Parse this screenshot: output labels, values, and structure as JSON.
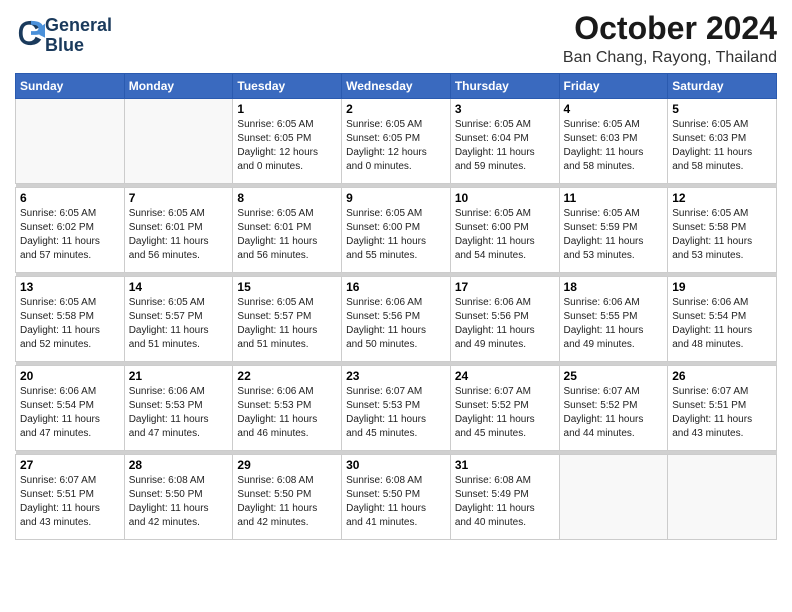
{
  "header": {
    "logo_line1": "General",
    "logo_line2": "Blue",
    "month": "October 2024",
    "location": "Ban Chang, Rayong, Thailand"
  },
  "weekdays": [
    "Sunday",
    "Monday",
    "Tuesday",
    "Wednesday",
    "Thursday",
    "Friday",
    "Saturday"
  ],
  "weeks": [
    [
      {
        "day": "",
        "info": ""
      },
      {
        "day": "",
        "info": ""
      },
      {
        "day": "1",
        "info": "Sunrise: 6:05 AM\nSunset: 6:05 PM\nDaylight: 12 hours\nand 0 minutes."
      },
      {
        "day": "2",
        "info": "Sunrise: 6:05 AM\nSunset: 6:05 PM\nDaylight: 12 hours\nand 0 minutes."
      },
      {
        "day": "3",
        "info": "Sunrise: 6:05 AM\nSunset: 6:04 PM\nDaylight: 11 hours\nand 59 minutes."
      },
      {
        "day": "4",
        "info": "Sunrise: 6:05 AM\nSunset: 6:03 PM\nDaylight: 11 hours\nand 58 minutes."
      },
      {
        "day": "5",
        "info": "Sunrise: 6:05 AM\nSunset: 6:03 PM\nDaylight: 11 hours\nand 58 minutes."
      }
    ],
    [
      {
        "day": "6",
        "info": "Sunrise: 6:05 AM\nSunset: 6:02 PM\nDaylight: 11 hours\nand 57 minutes."
      },
      {
        "day": "7",
        "info": "Sunrise: 6:05 AM\nSunset: 6:01 PM\nDaylight: 11 hours\nand 56 minutes."
      },
      {
        "day": "8",
        "info": "Sunrise: 6:05 AM\nSunset: 6:01 PM\nDaylight: 11 hours\nand 56 minutes."
      },
      {
        "day": "9",
        "info": "Sunrise: 6:05 AM\nSunset: 6:00 PM\nDaylight: 11 hours\nand 55 minutes."
      },
      {
        "day": "10",
        "info": "Sunrise: 6:05 AM\nSunset: 6:00 PM\nDaylight: 11 hours\nand 54 minutes."
      },
      {
        "day": "11",
        "info": "Sunrise: 6:05 AM\nSunset: 5:59 PM\nDaylight: 11 hours\nand 53 minutes."
      },
      {
        "day": "12",
        "info": "Sunrise: 6:05 AM\nSunset: 5:58 PM\nDaylight: 11 hours\nand 53 minutes."
      }
    ],
    [
      {
        "day": "13",
        "info": "Sunrise: 6:05 AM\nSunset: 5:58 PM\nDaylight: 11 hours\nand 52 minutes."
      },
      {
        "day": "14",
        "info": "Sunrise: 6:05 AM\nSunset: 5:57 PM\nDaylight: 11 hours\nand 51 minutes."
      },
      {
        "day": "15",
        "info": "Sunrise: 6:05 AM\nSunset: 5:57 PM\nDaylight: 11 hours\nand 51 minutes."
      },
      {
        "day": "16",
        "info": "Sunrise: 6:06 AM\nSunset: 5:56 PM\nDaylight: 11 hours\nand 50 minutes."
      },
      {
        "day": "17",
        "info": "Sunrise: 6:06 AM\nSunset: 5:56 PM\nDaylight: 11 hours\nand 49 minutes."
      },
      {
        "day": "18",
        "info": "Sunrise: 6:06 AM\nSunset: 5:55 PM\nDaylight: 11 hours\nand 49 minutes."
      },
      {
        "day": "19",
        "info": "Sunrise: 6:06 AM\nSunset: 5:54 PM\nDaylight: 11 hours\nand 48 minutes."
      }
    ],
    [
      {
        "day": "20",
        "info": "Sunrise: 6:06 AM\nSunset: 5:54 PM\nDaylight: 11 hours\nand 47 minutes."
      },
      {
        "day": "21",
        "info": "Sunrise: 6:06 AM\nSunset: 5:53 PM\nDaylight: 11 hours\nand 47 minutes."
      },
      {
        "day": "22",
        "info": "Sunrise: 6:06 AM\nSunset: 5:53 PM\nDaylight: 11 hours\nand 46 minutes."
      },
      {
        "day": "23",
        "info": "Sunrise: 6:07 AM\nSunset: 5:53 PM\nDaylight: 11 hours\nand 45 minutes."
      },
      {
        "day": "24",
        "info": "Sunrise: 6:07 AM\nSunset: 5:52 PM\nDaylight: 11 hours\nand 45 minutes."
      },
      {
        "day": "25",
        "info": "Sunrise: 6:07 AM\nSunset: 5:52 PM\nDaylight: 11 hours\nand 44 minutes."
      },
      {
        "day": "26",
        "info": "Sunrise: 6:07 AM\nSunset: 5:51 PM\nDaylight: 11 hours\nand 43 minutes."
      }
    ],
    [
      {
        "day": "27",
        "info": "Sunrise: 6:07 AM\nSunset: 5:51 PM\nDaylight: 11 hours\nand 43 minutes."
      },
      {
        "day": "28",
        "info": "Sunrise: 6:08 AM\nSunset: 5:50 PM\nDaylight: 11 hours\nand 42 minutes."
      },
      {
        "day": "29",
        "info": "Sunrise: 6:08 AM\nSunset: 5:50 PM\nDaylight: 11 hours\nand 42 minutes."
      },
      {
        "day": "30",
        "info": "Sunrise: 6:08 AM\nSunset: 5:50 PM\nDaylight: 11 hours\nand 41 minutes."
      },
      {
        "day": "31",
        "info": "Sunrise: 6:08 AM\nSunset: 5:49 PM\nDaylight: 11 hours\nand 40 minutes."
      },
      {
        "day": "",
        "info": ""
      },
      {
        "day": "",
        "info": ""
      }
    ]
  ]
}
